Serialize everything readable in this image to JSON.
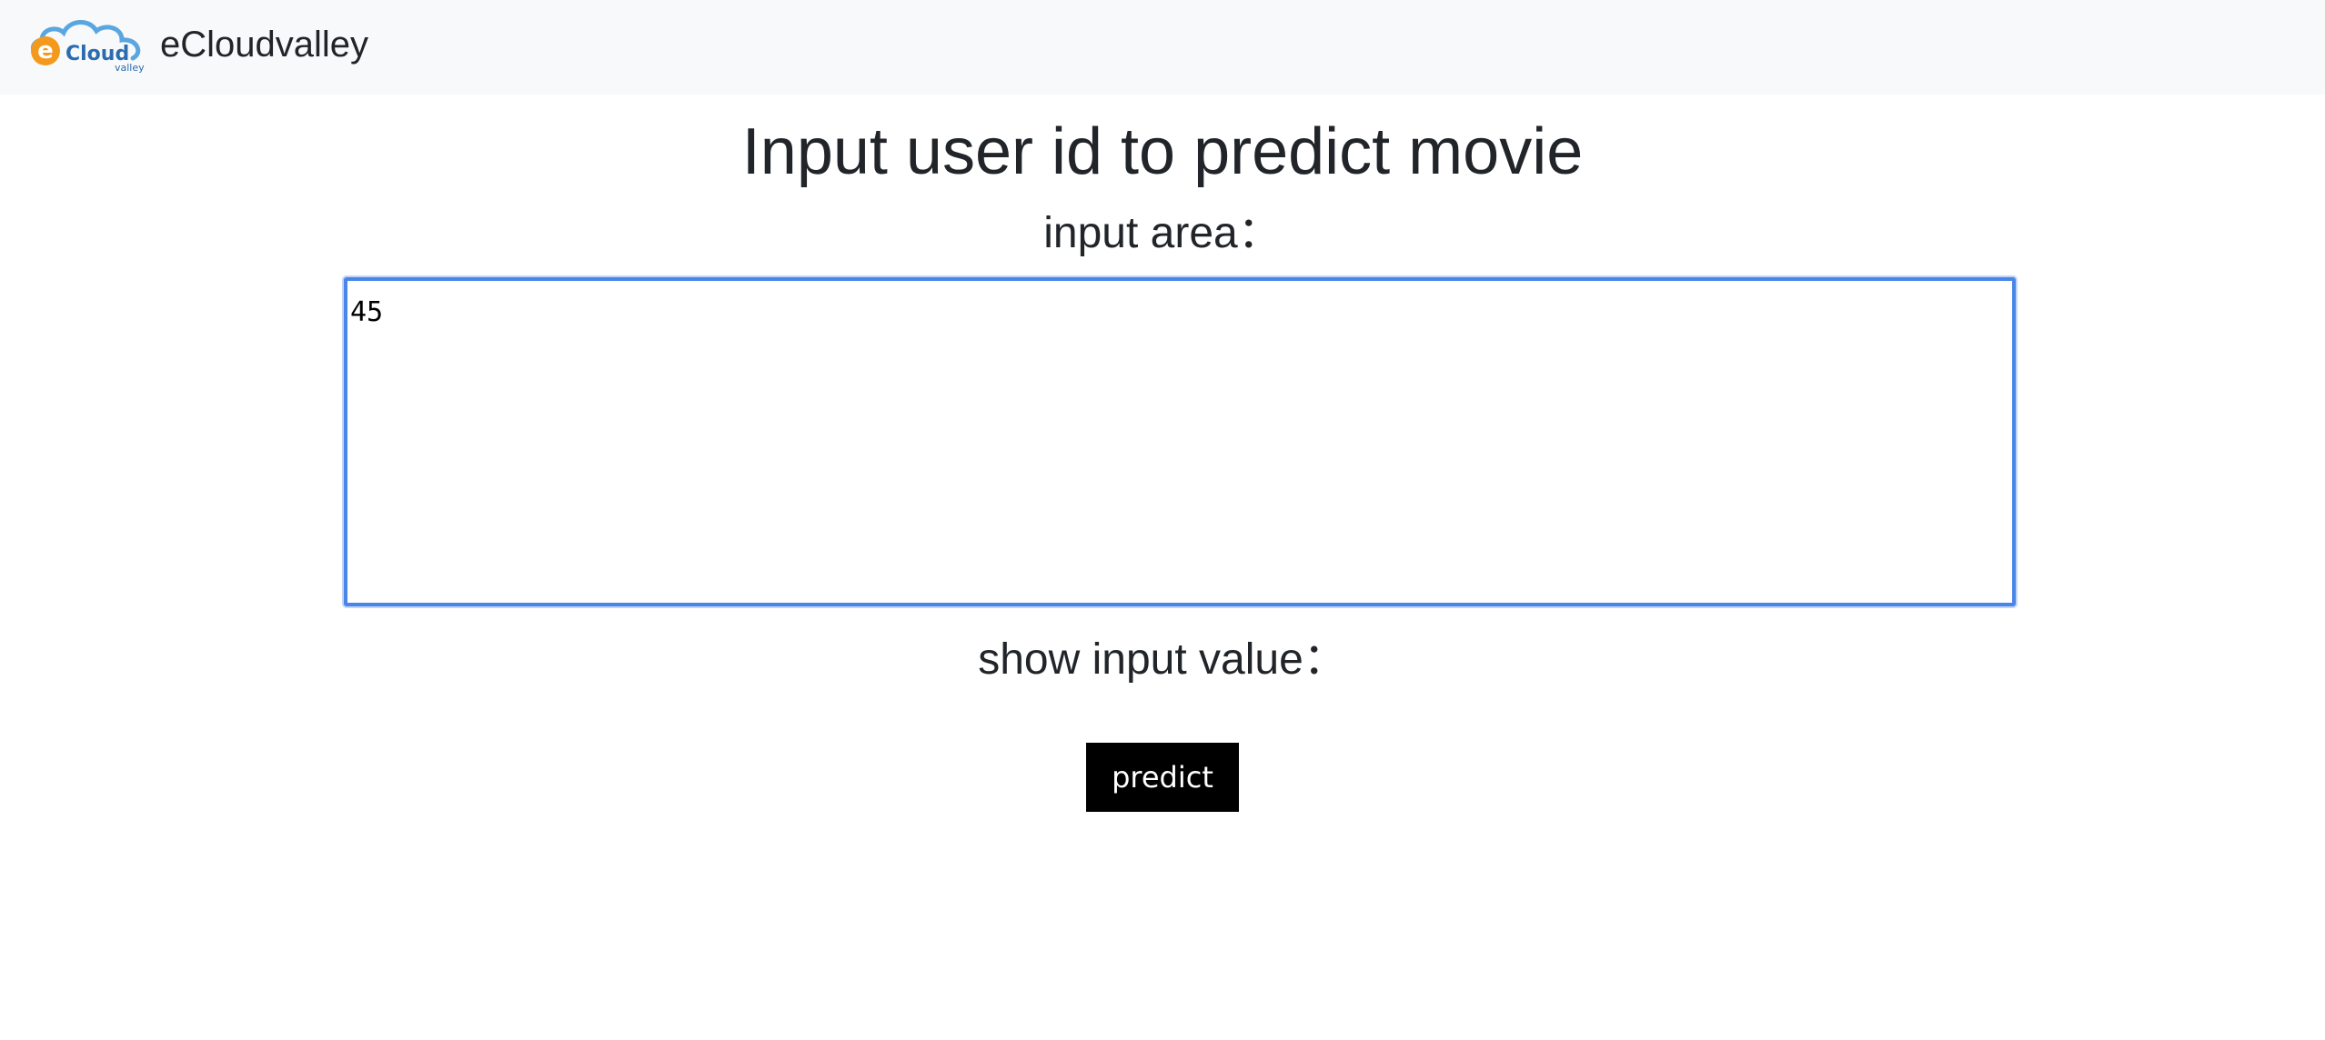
{
  "navbar": {
    "brand_name": "eCloudvalley",
    "logo": {
      "icon": "ecloudvalley-logo-icon",
      "logo_text": "eCloud",
      "logo_subtext": "valley",
      "colors": {
        "orange": "#f39a1e",
        "blue": "#2b6cb0",
        "cloud_outline": "#5aa6e0"
      }
    }
  },
  "main": {
    "title": "Input user id to predict movie",
    "input_label": "input area：",
    "input_value": "45",
    "output_label": "show input value：",
    "predict_label": "predict"
  },
  "colors": {
    "focus_ring": "#4a86e8",
    "button_bg": "#000000",
    "navbar_bg": "#f8f9fa"
  }
}
